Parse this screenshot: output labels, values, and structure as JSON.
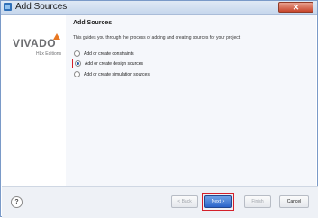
{
  "window": {
    "title": "Add Sources",
    "close_label": "✕"
  },
  "branding": {
    "vivado": "VIVADO",
    "vivado_edition": "HLx Editions",
    "xilinx_mark": "Σ",
    "xilinx": "XILINX",
    "xilinx_tagline": "ALL PROGRAMMABLE"
  },
  "main": {
    "heading": "Add Sources",
    "description": "This guides you through the process of adding and creating sources for your project",
    "options": [
      {
        "label": "Add or create constraints",
        "selected": false
      },
      {
        "label": "Add or create design sources",
        "selected": true
      },
      {
        "label": "Add or create simulation sources",
        "selected": false
      }
    ]
  },
  "footer": {
    "help_label": "?",
    "back_label": "< Back",
    "next_label": "Next >",
    "finish_label": "Finish",
    "cancel_label": "Cancel"
  },
  "colors": {
    "accent": "#2a64c9",
    "highlight": "#d4202a",
    "xilinx_red": "#c0102a",
    "vivado_orange": "#e87722"
  }
}
